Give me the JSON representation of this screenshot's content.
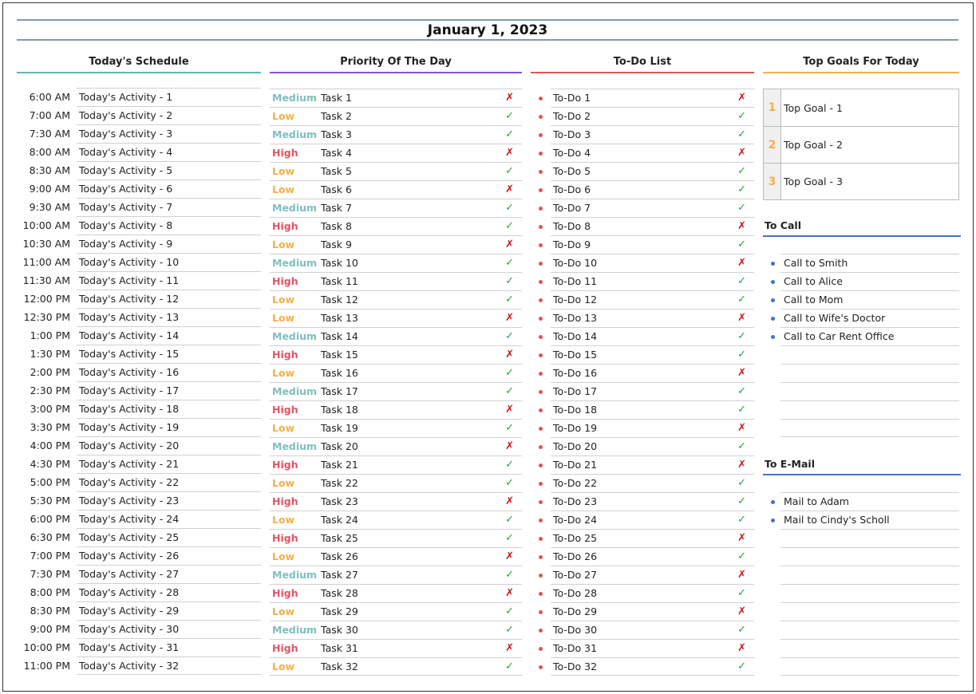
{
  "title": "January 1, 2023",
  "colors": {
    "schedule": "#5bb8b1",
    "priority": "#8a4fd0",
    "todo": "#e05555",
    "goals": "#f4b04a",
    "call": "#4472c4",
    "High": "#e05566",
    "Medium": "#7fbfbf",
    "Low": "#f4b04a",
    "check": "#1aa84a",
    "cross": "#c8161d"
  },
  "headers": {
    "schedule": "Today's Schedule",
    "priority": "Priority Of The Day",
    "todo": "To-Do List",
    "goals": "Top Goals For Today",
    "call": "To Call",
    "email": "To E-Mail"
  },
  "schedule": [
    {
      "time": "6:00 AM",
      "activity": "Today's Activity - 1"
    },
    {
      "time": "7:00 AM",
      "activity": "Today's Activity - 2"
    },
    {
      "time": "7:30 AM",
      "activity": "Today's Activity - 3"
    },
    {
      "time": "8:00 AM",
      "activity": "Today's Activity - 4"
    },
    {
      "time": "8:30 AM",
      "activity": "Today's Activity - 5"
    },
    {
      "time": "9:00 AM",
      "activity": "Today's Activity - 6"
    },
    {
      "time": "9:30 AM",
      "activity": "Today's Activity - 7"
    },
    {
      "time": "10:00 AM",
      "activity": "Today's Activity - 8"
    },
    {
      "time": "10:30 AM",
      "activity": "Today's Activity - 9"
    },
    {
      "time": "11:00 AM",
      "activity": "Today's Activity - 10"
    },
    {
      "time": "11:30 AM",
      "activity": "Today's Activity - 11"
    },
    {
      "time": "12:00 PM",
      "activity": "Today's Activity - 12"
    },
    {
      "time": "12:30 PM",
      "activity": "Today's Activity - 13"
    },
    {
      "time": "1:00 PM",
      "activity": "Today's Activity - 14"
    },
    {
      "time": "1:30 PM",
      "activity": "Today's Activity - 15"
    },
    {
      "time": "2:00 PM",
      "activity": "Today's Activity - 16"
    },
    {
      "time": "2:30 PM",
      "activity": "Today's Activity - 17"
    },
    {
      "time": "3:00 PM",
      "activity": "Today's Activity - 18"
    },
    {
      "time": "3:30 PM",
      "activity": "Today's Activity - 19"
    },
    {
      "time": "4:00 PM",
      "activity": "Today's Activity - 20"
    },
    {
      "time": "4:30 PM",
      "activity": "Today's Activity - 21"
    },
    {
      "time": "5:00 PM",
      "activity": "Today's Activity - 22"
    },
    {
      "time": "5:30 PM",
      "activity": "Today's Activity - 23"
    },
    {
      "time": "6:00 PM",
      "activity": "Today's Activity - 24"
    },
    {
      "time": "6:30 PM",
      "activity": "Today's Activity - 25"
    },
    {
      "time": "7:00 PM",
      "activity": "Today's Activity - 26"
    },
    {
      "time": "7:30 PM",
      "activity": "Today's Activity - 27"
    },
    {
      "time": "8:00 PM",
      "activity": "Today's Activity - 28"
    },
    {
      "time": "8:30 PM",
      "activity": "Today's Activity - 29"
    },
    {
      "time": "9:00 PM",
      "activity": "Today's Activity - 30"
    },
    {
      "time": "10:00 PM",
      "activity": "Today's Activity - 31"
    },
    {
      "time": "11:00 PM",
      "activity": "Today's Activity - 32"
    }
  ],
  "tasks": [
    {
      "priority": "Medium",
      "task": "Task 1",
      "done": false
    },
    {
      "priority": "Low",
      "task": "Task 2",
      "done": true
    },
    {
      "priority": "Medium",
      "task": "Task 3",
      "done": true
    },
    {
      "priority": "High",
      "task": "Task 4",
      "done": false
    },
    {
      "priority": "Low",
      "task": "Task 5",
      "done": true
    },
    {
      "priority": "Low",
      "task": "Task 6",
      "done": false
    },
    {
      "priority": "Medium",
      "task": "Task 7",
      "done": true
    },
    {
      "priority": "High",
      "task": "Task 8",
      "done": true
    },
    {
      "priority": "Low",
      "task": "Task 9",
      "done": false
    },
    {
      "priority": "Medium",
      "task": "Task 10",
      "done": true
    },
    {
      "priority": "High",
      "task": "Task 11",
      "done": true
    },
    {
      "priority": "Low",
      "task": "Task 12",
      "done": true
    },
    {
      "priority": "Low",
      "task": "Task 13",
      "done": false
    },
    {
      "priority": "Medium",
      "task": "Task 14",
      "done": true
    },
    {
      "priority": "High",
      "task": "Task 15",
      "done": false
    },
    {
      "priority": "Low",
      "task": "Task 16",
      "done": true
    },
    {
      "priority": "Medium",
      "task": "Task 17",
      "done": true
    },
    {
      "priority": "High",
      "task": "Task 18",
      "done": false
    },
    {
      "priority": "Low",
      "task": "Task 19",
      "done": true
    },
    {
      "priority": "Medium",
      "task": "Task 20",
      "done": false
    },
    {
      "priority": "High",
      "task": "Task 21",
      "done": true
    },
    {
      "priority": "Low",
      "task": "Task 22",
      "done": true
    },
    {
      "priority": "High",
      "task": "Task 23",
      "done": false
    },
    {
      "priority": "Low",
      "task": "Task 24",
      "done": true
    },
    {
      "priority": "High",
      "task": "Task 25",
      "done": true
    },
    {
      "priority": "Low",
      "task": "Task 26",
      "done": false
    },
    {
      "priority": "Medium",
      "task": "Task 27",
      "done": true
    },
    {
      "priority": "High",
      "task": "Task 28",
      "done": false
    },
    {
      "priority": "Low",
      "task": "Task 29",
      "done": true
    },
    {
      "priority": "Medium",
      "task": "Task 30",
      "done": true
    },
    {
      "priority": "High",
      "task": "Task 31",
      "done": false
    },
    {
      "priority": "Low",
      "task": "Task 32",
      "done": true
    }
  ],
  "todos": [
    {
      "text": "To-Do 1",
      "done": false
    },
    {
      "text": "To-Do 2",
      "done": true
    },
    {
      "text": "To-Do 3",
      "done": true
    },
    {
      "text": "To-Do 4",
      "done": false
    },
    {
      "text": "To-Do 5",
      "done": true
    },
    {
      "text": "To-Do 6",
      "done": true
    },
    {
      "text": "To-Do 7",
      "done": true
    },
    {
      "text": "To-Do 8",
      "done": false
    },
    {
      "text": "To-Do 9",
      "done": true
    },
    {
      "text": "To-Do 10",
      "done": false
    },
    {
      "text": "To-Do 11",
      "done": true
    },
    {
      "text": "To-Do 12",
      "done": true
    },
    {
      "text": "To-Do 13",
      "done": false
    },
    {
      "text": "To-Do 14",
      "done": true
    },
    {
      "text": "To-Do 15",
      "done": true
    },
    {
      "text": "To-Do 16",
      "done": false
    },
    {
      "text": "To-Do 17",
      "done": true
    },
    {
      "text": "To-Do 18",
      "done": true
    },
    {
      "text": "To-Do 19",
      "done": false
    },
    {
      "text": "To-Do 20",
      "done": true
    },
    {
      "text": "To-Do 21",
      "done": false
    },
    {
      "text": "To-Do 22",
      "done": true
    },
    {
      "text": "To-Do 23",
      "done": true
    },
    {
      "text": "To-Do 24",
      "done": true
    },
    {
      "text": "To-Do 25",
      "done": false
    },
    {
      "text": "To-Do 26",
      "done": true
    },
    {
      "text": "To-Do 27",
      "done": false
    },
    {
      "text": "To-Do 28",
      "done": true
    },
    {
      "text": "To-Do 29",
      "done": false
    },
    {
      "text": "To-Do 30",
      "done": true
    },
    {
      "text": "To-Do 31",
      "done": false
    },
    {
      "text": "To-Do 32",
      "done": true
    }
  ],
  "marks": {
    "done": "✓",
    "not_done": "✗"
  },
  "goals": [
    {
      "num": "1",
      "text": "Top Goal - 1"
    },
    {
      "num": "2",
      "text": "Top Goal - 2"
    },
    {
      "num": "3",
      "text": "Top Goal - 3"
    }
  ],
  "calls": [
    "Call to Smith",
    "Call to Alice",
    "Call to Mom",
    "Call to Wife's Doctor",
    "Call to Car Rent Office",
    "",
    "",
    "",
    "",
    ""
  ],
  "emails": [
    "Mail to Adam",
    "Mail to Cindy's Scholl",
    "",
    "",
    "",
    "",
    "",
    "",
    "",
    ""
  ]
}
